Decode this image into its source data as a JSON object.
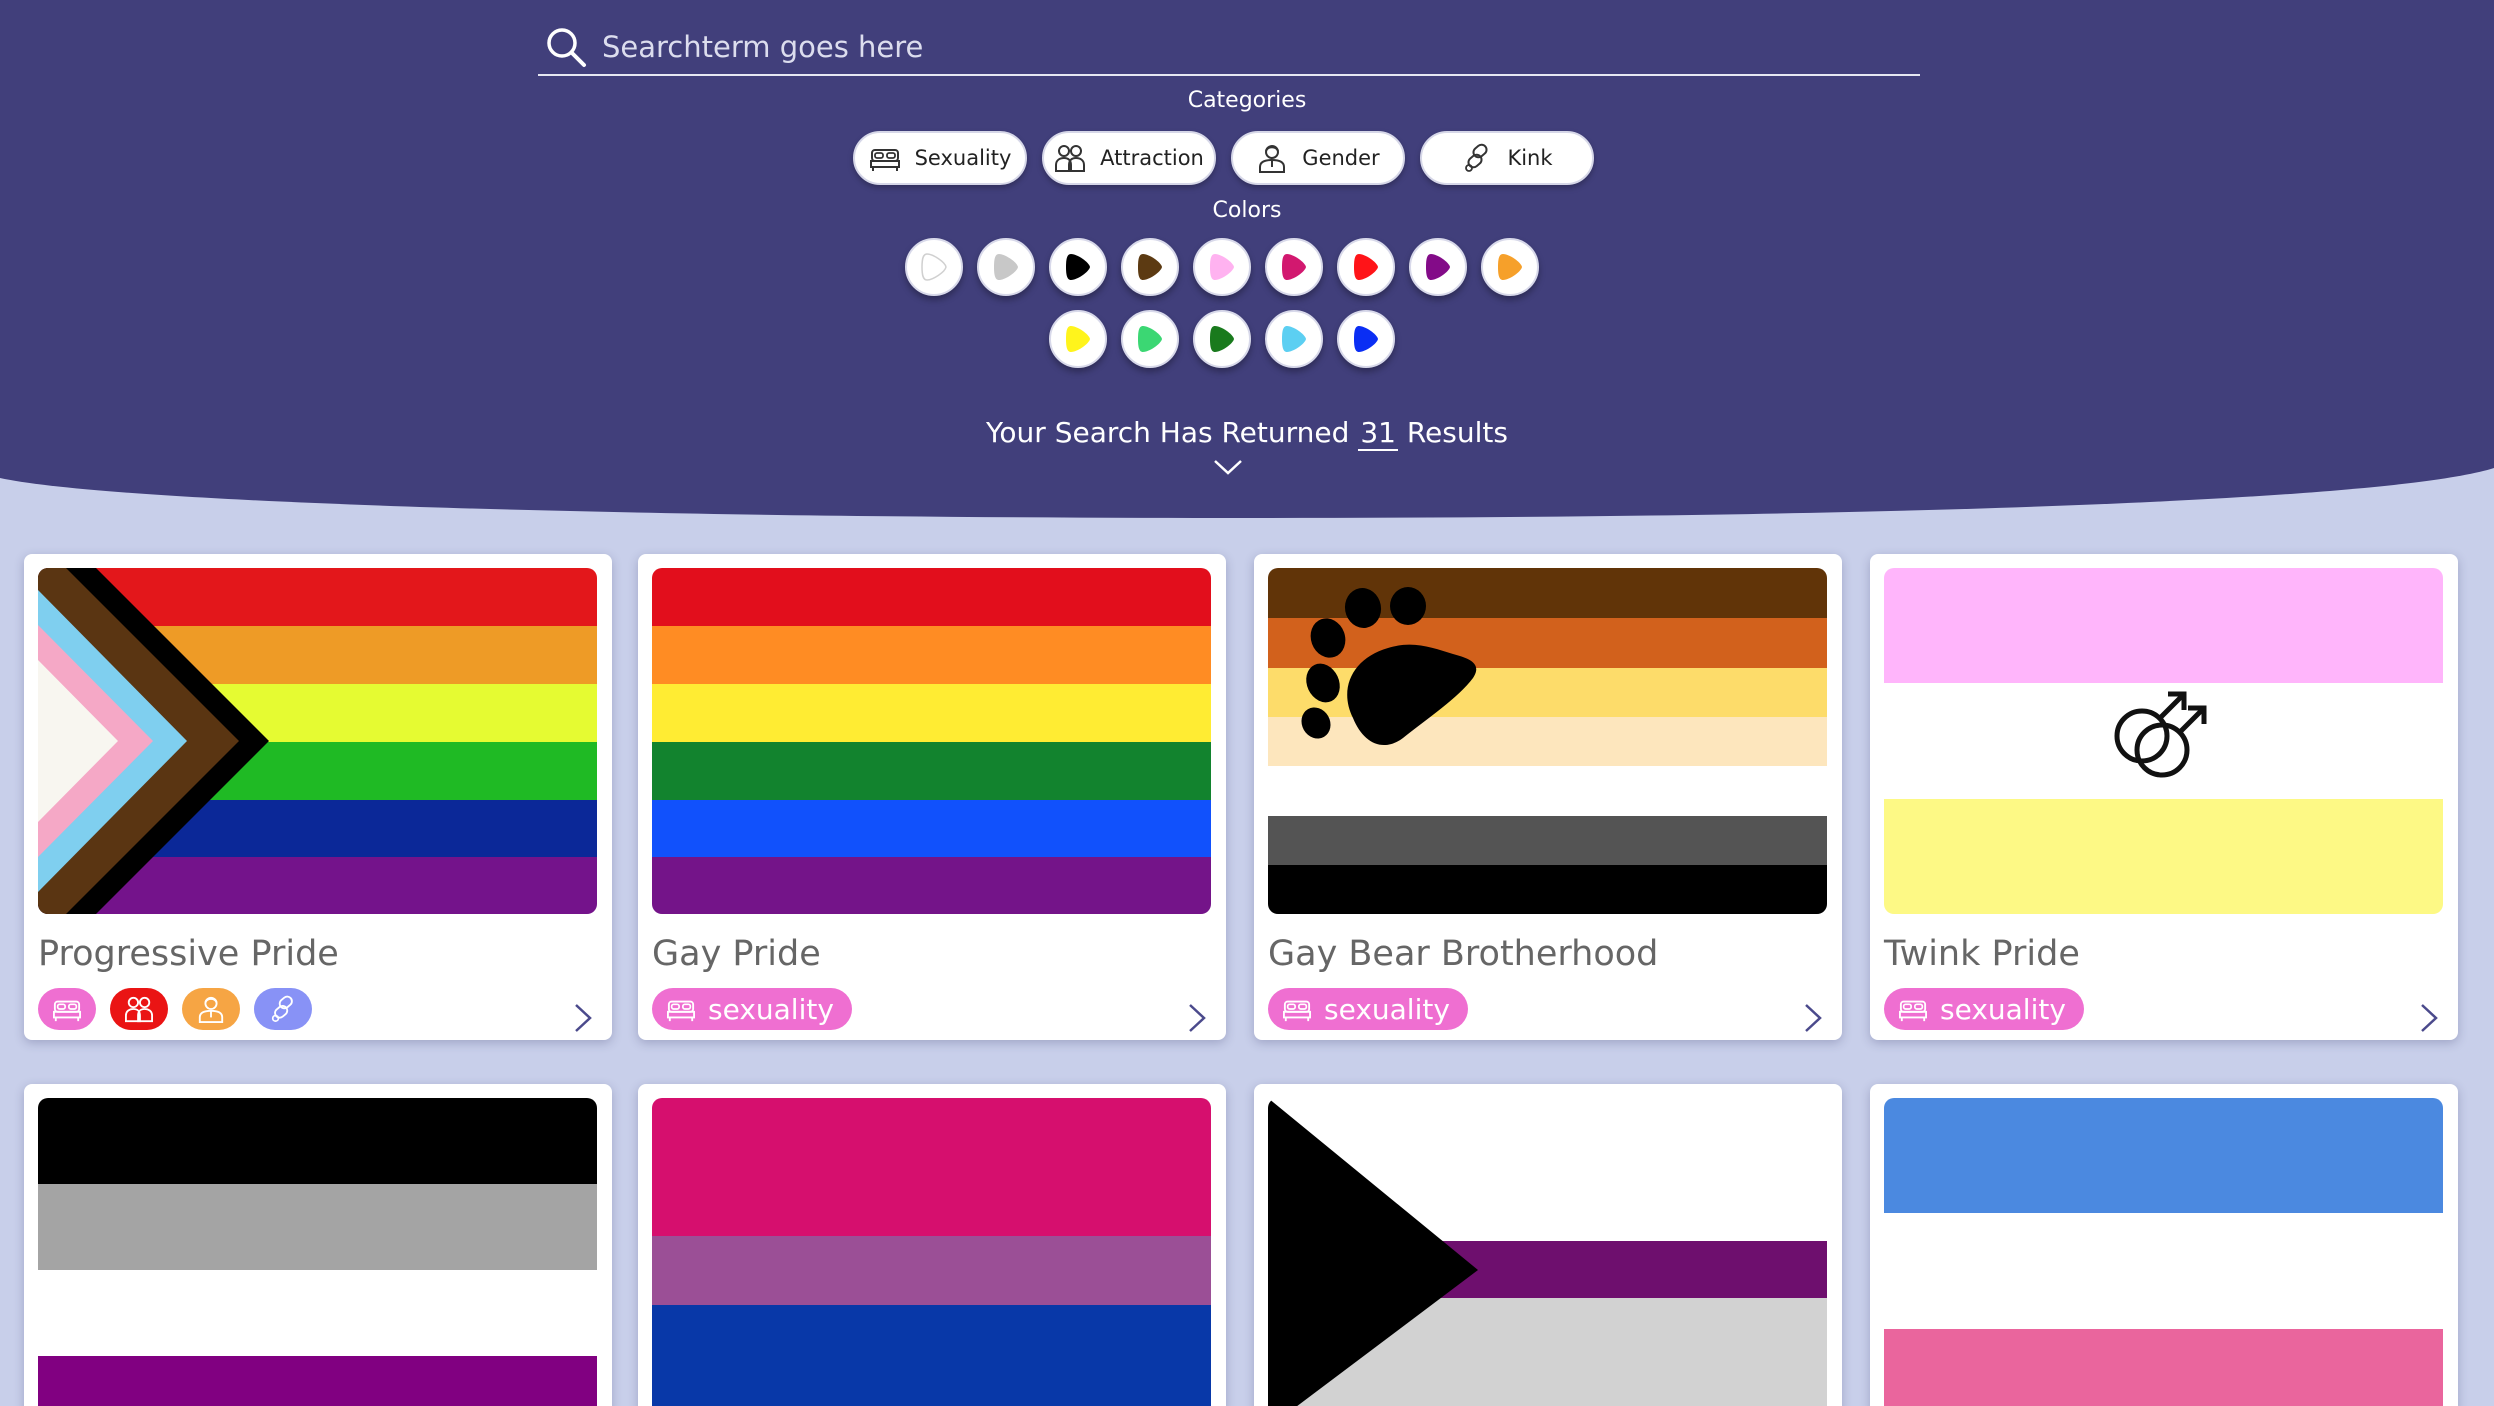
{
  "search": {
    "placeholder": "Searchterm goes here"
  },
  "filters": {
    "categories_title": "Categories",
    "categories": [
      {
        "label": "Sexuality",
        "icon": "bed-icon"
      },
      {
        "label": "Attraction",
        "icon": "couple-icon"
      },
      {
        "label": "Gender",
        "icon": "person-icon"
      },
      {
        "label": "Kink",
        "icon": "chain-link-icon"
      }
    ],
    "colors_title": "Colors",
    "colors": [
      "#ffffff",
      "#c8c8c8",
      "#000000",
      "#5c3a12",
      "#ffb2f0",
      "#d2186f",
      "#ff1418",
      "#830b88",
      "#f6a02a",
      "#fff41c",
      "#3bd773",
      "#197a1d",
      "#5ccff2",
      "#0a2ef4"
    ]
  },
  "results": {
    "prefix": "Your Search Has Returned",
    "count": "31",
    "suffix": "Results"
  },
  "cards": [
    {
      "title": "Progressive Pride",
      "tags": [
        "sexuality",
        "attraction",
        "gender",
        "kink"
      ]
    },
    {
      "title": "Gay Pride",
      "tag_label": "sexuality"
    },
    {
      "title": "Gay Bear Brotherhood",
      "tag_label": "sexuality"
    },
    {
      "title": "Twink Pride",
      "tag_label": "sexuality"
    },
    {
      "title": ""
    },
    {
      "title": ""
    },
    {
      "title": ""
    },
    {
      "title": ""
    }
  ],
  "theme": {
    "header_bg": "#413f7b",
    "page_bg": "#c8cfea",
    "tag_sexuality": "#ef6fd1",
    "tag_attraction": "#ea1414",
    "tag_gender": "#f6a544",
    "tag_kink": "#8892f6"
  }
}
